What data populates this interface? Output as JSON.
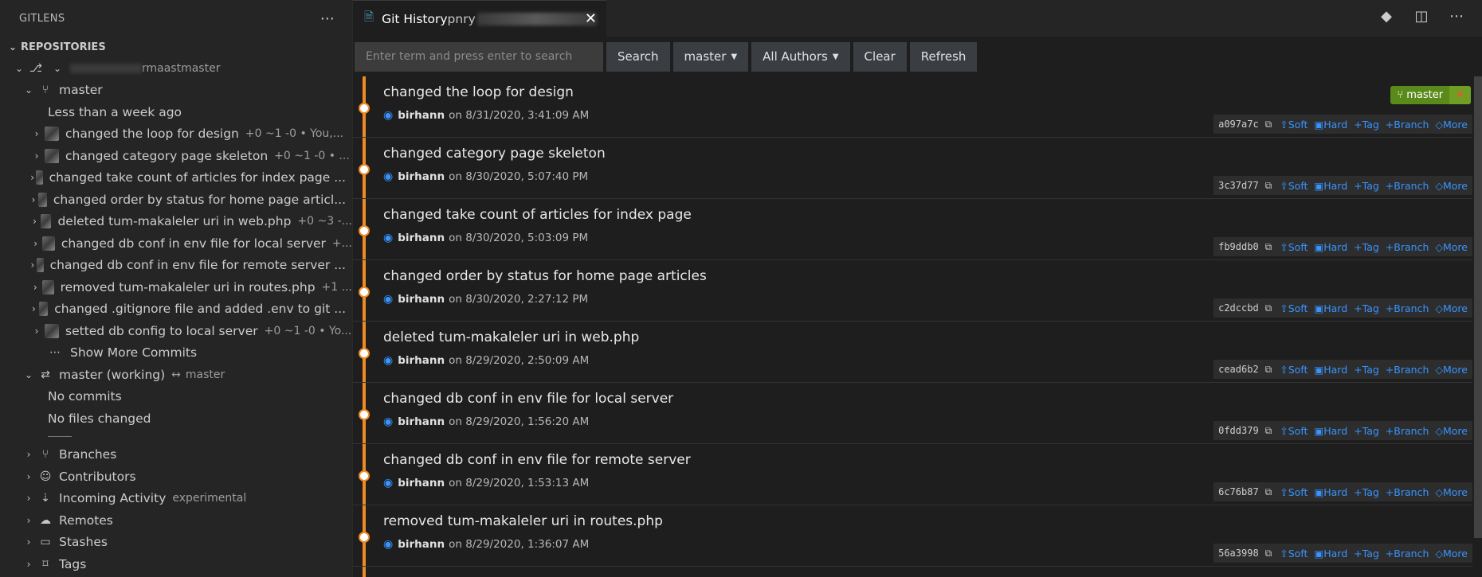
{
  "sidebar": {
    "title": "GITLENS",
    "section": "REPOSITORIES",
    "repo_name": "rmaastmaster",
    "branch": "master",
    "time_group": "Less than a week ago",
    "commits": [
      {
        "subject": "changed the loop for design",
        "stats": "+0 ~1 -0  •  You,..."
      },
      {
        "subject": "changed category page skeleton",
        "stats": "+0 ~1 -0  •  ..."
      },
      {
        "subject": "changed take count of articles for index page ...",
        "stats": ""
      },
      {
        "subject": "changed order by status for home page articl...",
        "stats": ""
      },
      {
        "subject": "deleted tum-makaleler uri in web.php",
        "stats": "+0 ~3 -..."
      },
      {
        "subject": "changed db conf in env file for local server",
        "stats": "+..."
      },
      {
        "subject": "changed db conf in env file for remote server ...",
        "stats": ""
      },
      {
        "subject": "removed tum-makaleler uri in routes.php",
        "stats": "+1 ..."
      },
      {
        "subject": "changed .gitignore file and added .env to git  ...",
        "stats": ""
      },
      {
        "subject": "setted db config to local server",
        "stats": "+0 ~1 -0  •  Yo..."
      }
    ],
    "show_more": "Show More Commits",
    "working_branch": "master (working)",
    "working_arrow": "↔",
    "working_target": "master",
    "no_commits": "No commits",
    "no_files": "No files changed",
    "groups": [
      {
        "label": "Branches",
        "extra": ""
      },
      {
        "label": "Contributors",
        "extra": ""
      },
      {
        "label": "Incoming Activity",
        "extra": "experimental"
      },
      {
        "label": "Remotes",
        "extra": ""
      },
      {
        "label": "Stashes",
        "extra": ""
      },
      {
        "label": "Tags",
        "extra": ""
      }
    ]
  },
  "tab": {
    "title": "Git History",
    "suffix": "pnry"
  },
  "toolbar": {
    "search_placeholder": "Enter term and press enter to search",
    "search_label": "Search",
    "branch_label": "master",
    "authors_label": "All Authors",
    "clear_label": "Clear",
    "refresh_label": "Refresh"
  },
  "branch_badge": {
    "name": "master"
  },
  "action_labels": {
    "soft": "Soft",
    "hard": "Hard",
    "tag": "Tag",
    "branch": "Branch",
    "more": "More"
  },
  "commits": [
    {
      "subject": "changed the loop for design",
      "author": "birhann",
      "date": "on 8/31/2020, 3:41:09 AM",
      "hash": "a097a7c"
    },
    {
      "subject": "changed category page skeleton",
      "author": "birhann",
      "date": "on 8/30/2020, 5:07:40 PM",
      "hash": "3c37d77"
    },
    {
      "subject": "changed take count of articles for index page",
      "author": "birhann",
      "date": "on 8/30/2020, 5:03:09 PM",
      "hash": "fb9ddb0"
    },
    {
      "subject": "changed order by status for home page articles",
      "author": "birhann",
      "date": "on 8/30/2020, 2:27:12 PM",
      "hash": "c2dccbd"
    },
    {
      "subject": "deleted tum-makaleler uri in web.php",
      "author": "birhann",
      "date": "on 8/29/2020, 2:50:09 AM",
      "hash": "cead6b2"
    },
    {
      "subject": "changed db conf in env file for local server",
      "author": "birhann",
      "date": "on 8/29/2020, 1:56:20 AM",
      "hash": "0fdd379"
    },
    {
      "subject": "changed db conf in env file for remote server",
      "author": "birhann",
      "date": "on 8/29/2020, 1:53:13 AM",
      "hash": "6c76b87"
    },
    {
      "subject": "removed tum-makaleler uri in routes.php",
      "author": "birhann",
      "date": "on 8/29/2020, 1:36:07 AM",
      "hash": "56a3998"
    }
  ]
}
